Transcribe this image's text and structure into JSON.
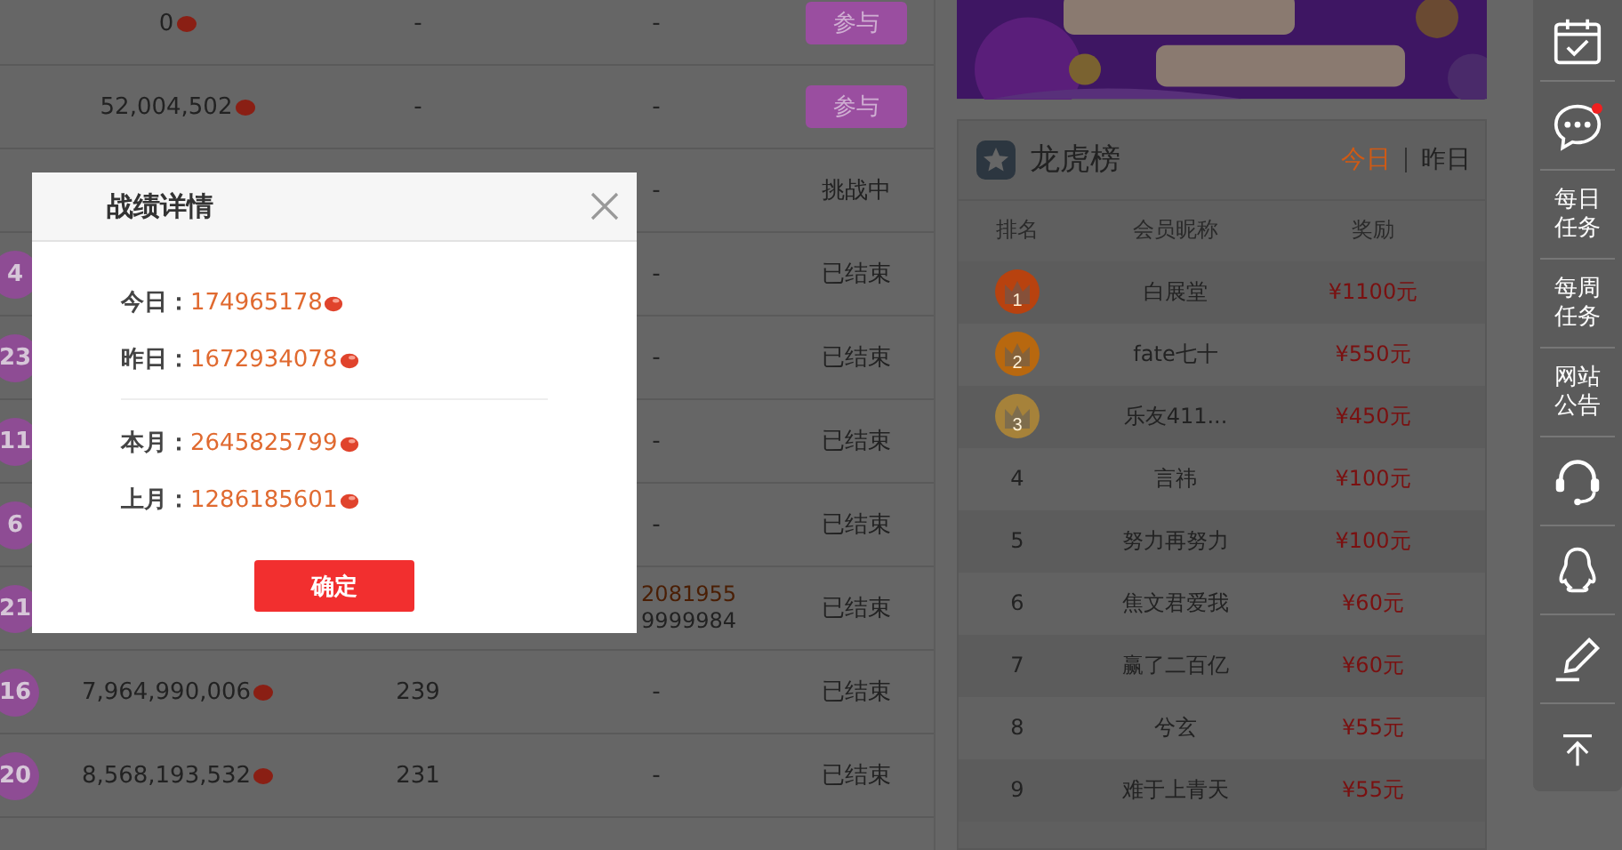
{
  "table": {
    "rows": [
      {
        "amount": "0",
        "column_3": "-",
        "column_4": [
          {
            "text": "-",
            "highlighted": false
          }
        ],
        "status": {
          "kind": "button",
          "label": "参与"
        }
      },
      {
        "amount": "52,004,502",
        "column_3": "-",
        "column_4": [
          {
            "text": "-",
            "highlighted": false
          }
        ],
        "status": {
          "kind": "button",
          "label": "参与"
        }
      },
      {
        "column_4": [
          {
            "text": "-",
            "highlighted": false
          }
        ],
        "status": {
          "kind": "text",
          "label": "挑战中"
        }
      },
      {
        "badge": "4",
        "column_4": [
          {
            "text": "-",
            "highlighted": false
          }
        ],
        "status": {
          "kind": "text",
          "label": "已结束"
        }
      },
      {
        "badge": "23",
        "column_4": [
          {
            "text": "-",
            "highlighted": false
          }
        ],
        "status": {
          "kind": "text",
          "label": "已结束"
        }
      },
      {
        "badge": "11",
        "column_4": [
          {
            "text": "-",
            "highlighted": false
          }
        ],
        "status": {
          "kind": "text",
          "label": "已结束"
        }
      },
      {
        "badge": "6",
        "column_4": [
          {
            "text": "-",
            "highlighted": false
          }
        ],
        "status": {
          "kind": "text",
          "label": "已结束"
        }
      },
      {
        "badge": "21",
        "column_4": [
          {
            "text": "2081955",
            "highlighted": true
          },
          {
            "text": "9999984",
            "highlighted": false
          }
        ],
        "status": {
          "kind": "text",
          "label": "已结束"
        }
      },
      {
        "badge": "16",
        "amount": "7,964,990,006",
        "column_3": "239",
        "column_4": [
          {
            "text": "-",
            "highlighted": false
          }
        ],
        "status": {
          "kind": "text",
          "label": "已结束"
        }
      },
      {
        "badge": "20",
        "amount": "8,568,193,532",
        "column_3": "231",
        "column_4": [
          {
            "text": "-",
            "highlighted": false
          }
        ],
        "status": {
          "kind": "text",
          "label": "已结束"
        }
      }
    ]
  },
  "ranking": {
    "title": "龙虎榜",
    "periods": [
      {
        "label": "今日",
        "selected": true
      },
      {
        "label": "昨日",
        "selected": false
      }
    ],
    "columns": [
      "排名",
      "会员昵称",
      "奖励"
    ],
    "rows": [
      {
        "kind": "medal",
        "rank": "1",
        "color": "#b8420f",
        "name": "白展堂",
        "prize": "¥1100元"
      },
      {
        "kind": "medal",
        "rank": "2",
        "color": "#b8680f",
        "name": "fate七十",
        "prize": "¥550元"
      },
      {
        "kind": "medal",
        "rank": "3",
        "color": "#a6823a",
        "name": "乐友411...",
        "prize": "¥450元"
      },
      {
        "kind": "plain",
        "rank": "4",
        "name": "言祎",
        "prize": "¥100元"
      },
      {
        "kind": "plain",
        "rank": "5",
        "name": "努力再努力",
        "prize": "¥100元"
      },
      {
        "kind": "plain",
        "rank": "6",
        "name": "焦文君爱我",
        "prize": "¥60元"
      },
      {
        "kind": "plain",
        "rank": "7",
        "name": "赢了二百亿",
        "prize": "¥60元"
      },
      {
        "kind": "plain",
        "rank": "8",
        "name": "兮玄",
        "prize": "¥55元"
      },
      {
        "kind": "plain",
        "rank": "9",
        "name": "难于上青天",
        "prize": "¥55元"
      }
    ]
  },
  "sidebar": {
    "items": [
      {
        "kind": "calendar"
      },
      {
        "kind": "chat",
        "notification": true
      },
      {
        "kind": "text",
        "label": "每日任务"
      },
      {
        "kind": "text",
        "label": "每周任务"
      },
      {
        "kind": "text",
        "label": "网站公告"
      },
      {
        "kind": "headset"
      },
      {
        "kind": "penguin"
      },
      {
        "kind": "pen"
      },
      {
        "kind": "top"
      }
    ]
  },
  "dialog": {
    "title": "战绩详情",
    "groups": [
      [
        {
          "label": "今日：",
          "value": "174965178"
        },
        {
          "label": "昨日：",
          "value": "1672934078"
        }
      ],
      [
        {
          "label": "本月：",
          "value": "2645825799"
        },
        {
          "label": "上月：",
          "value": "1286185601"
        }
      ]
    ],
    "confirm": "确定"
  }
}
